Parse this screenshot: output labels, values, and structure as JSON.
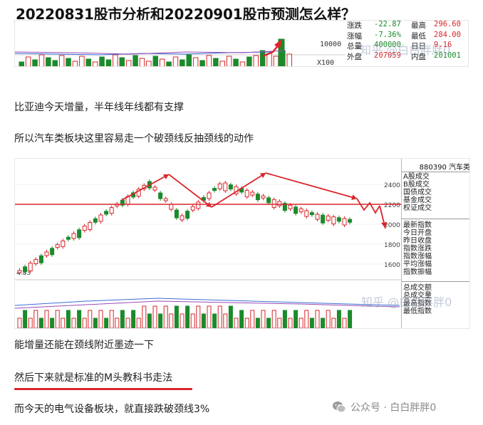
{
  "title": "20220831股市分析和20220901股市预测怎么样？",
  "chart_top": {
    "axis_label": "10000",
    "axis_unit": "X100",
    "stats": [
      {
        "label1": "涨跌",
        "value1": "-22.87",
        "label2": "最高",
        "value2": "296.60"
      },
      {
        "label1": "涨幅",
        "value1": "-7.36%",
        "label2": "最低",
        "value2": "284.00"
      },
      {
        "label1": "总量",
        "value1": "400000",
        "label2": "日日",
        "value2": "9.16"
      },
      {
        "label1": "外盘",
        "value1": "207059",
        "label2": "内盘",
        "value2": "201001"
      }
    ],
    "watermark": "知乎 @白白胖胖0",
    "colors": {
      "up": "#d9262b",
      "down": "#1b8a2c",
      "value_red": "#d9262b",
      "value_green": "#1b8a2c"
    }
  },
  "paragraphs": {
    "p1": "比亚迪今天增量，半年线年线都有支撑",
    "p2": "所以汽车类板块这里容易走一个破颈线反抽颈线的动作",
    "p3": "能增量还能在颈线附近墨迹一下",
    "p4": "然后下来就是标准的M头教科书走法",
    "p5": "而今天的电气设备板块，就直接跌破颈线3%"
  },
  "chart_main": {
    "code_title": "880390 汽车类",
    "y_ticks": [
      "2400",
      "2200",
      "2000",
      "1800",
      "1600"
    ],
    "left_label": "4.83",
    "side_items": [
      "A股成交",
      "B股成交",
      "国债成交",
      "基金成交",
      "权证成交",
      "最新指数",
      "今日开盘",
      "昨日收盘",
      "指数涨跌",
      "指数涨幅",
      "平均涨幅",
      "指数振幅",
      "总成交额",
      "总成交量",
      "最高指数",
      "最低指数"
    ],
    "watermark": "知乎 @白白胖胖0",
    "colors": {
      "neckline": "#d9262b",
      "arrow": "#d9262b",
      "up": "#d9262b",
      "down": "#1b8a2c"
    }
  },
  "footer": {
    "label": "公众号 · 白白胖胖0"
  }
}
